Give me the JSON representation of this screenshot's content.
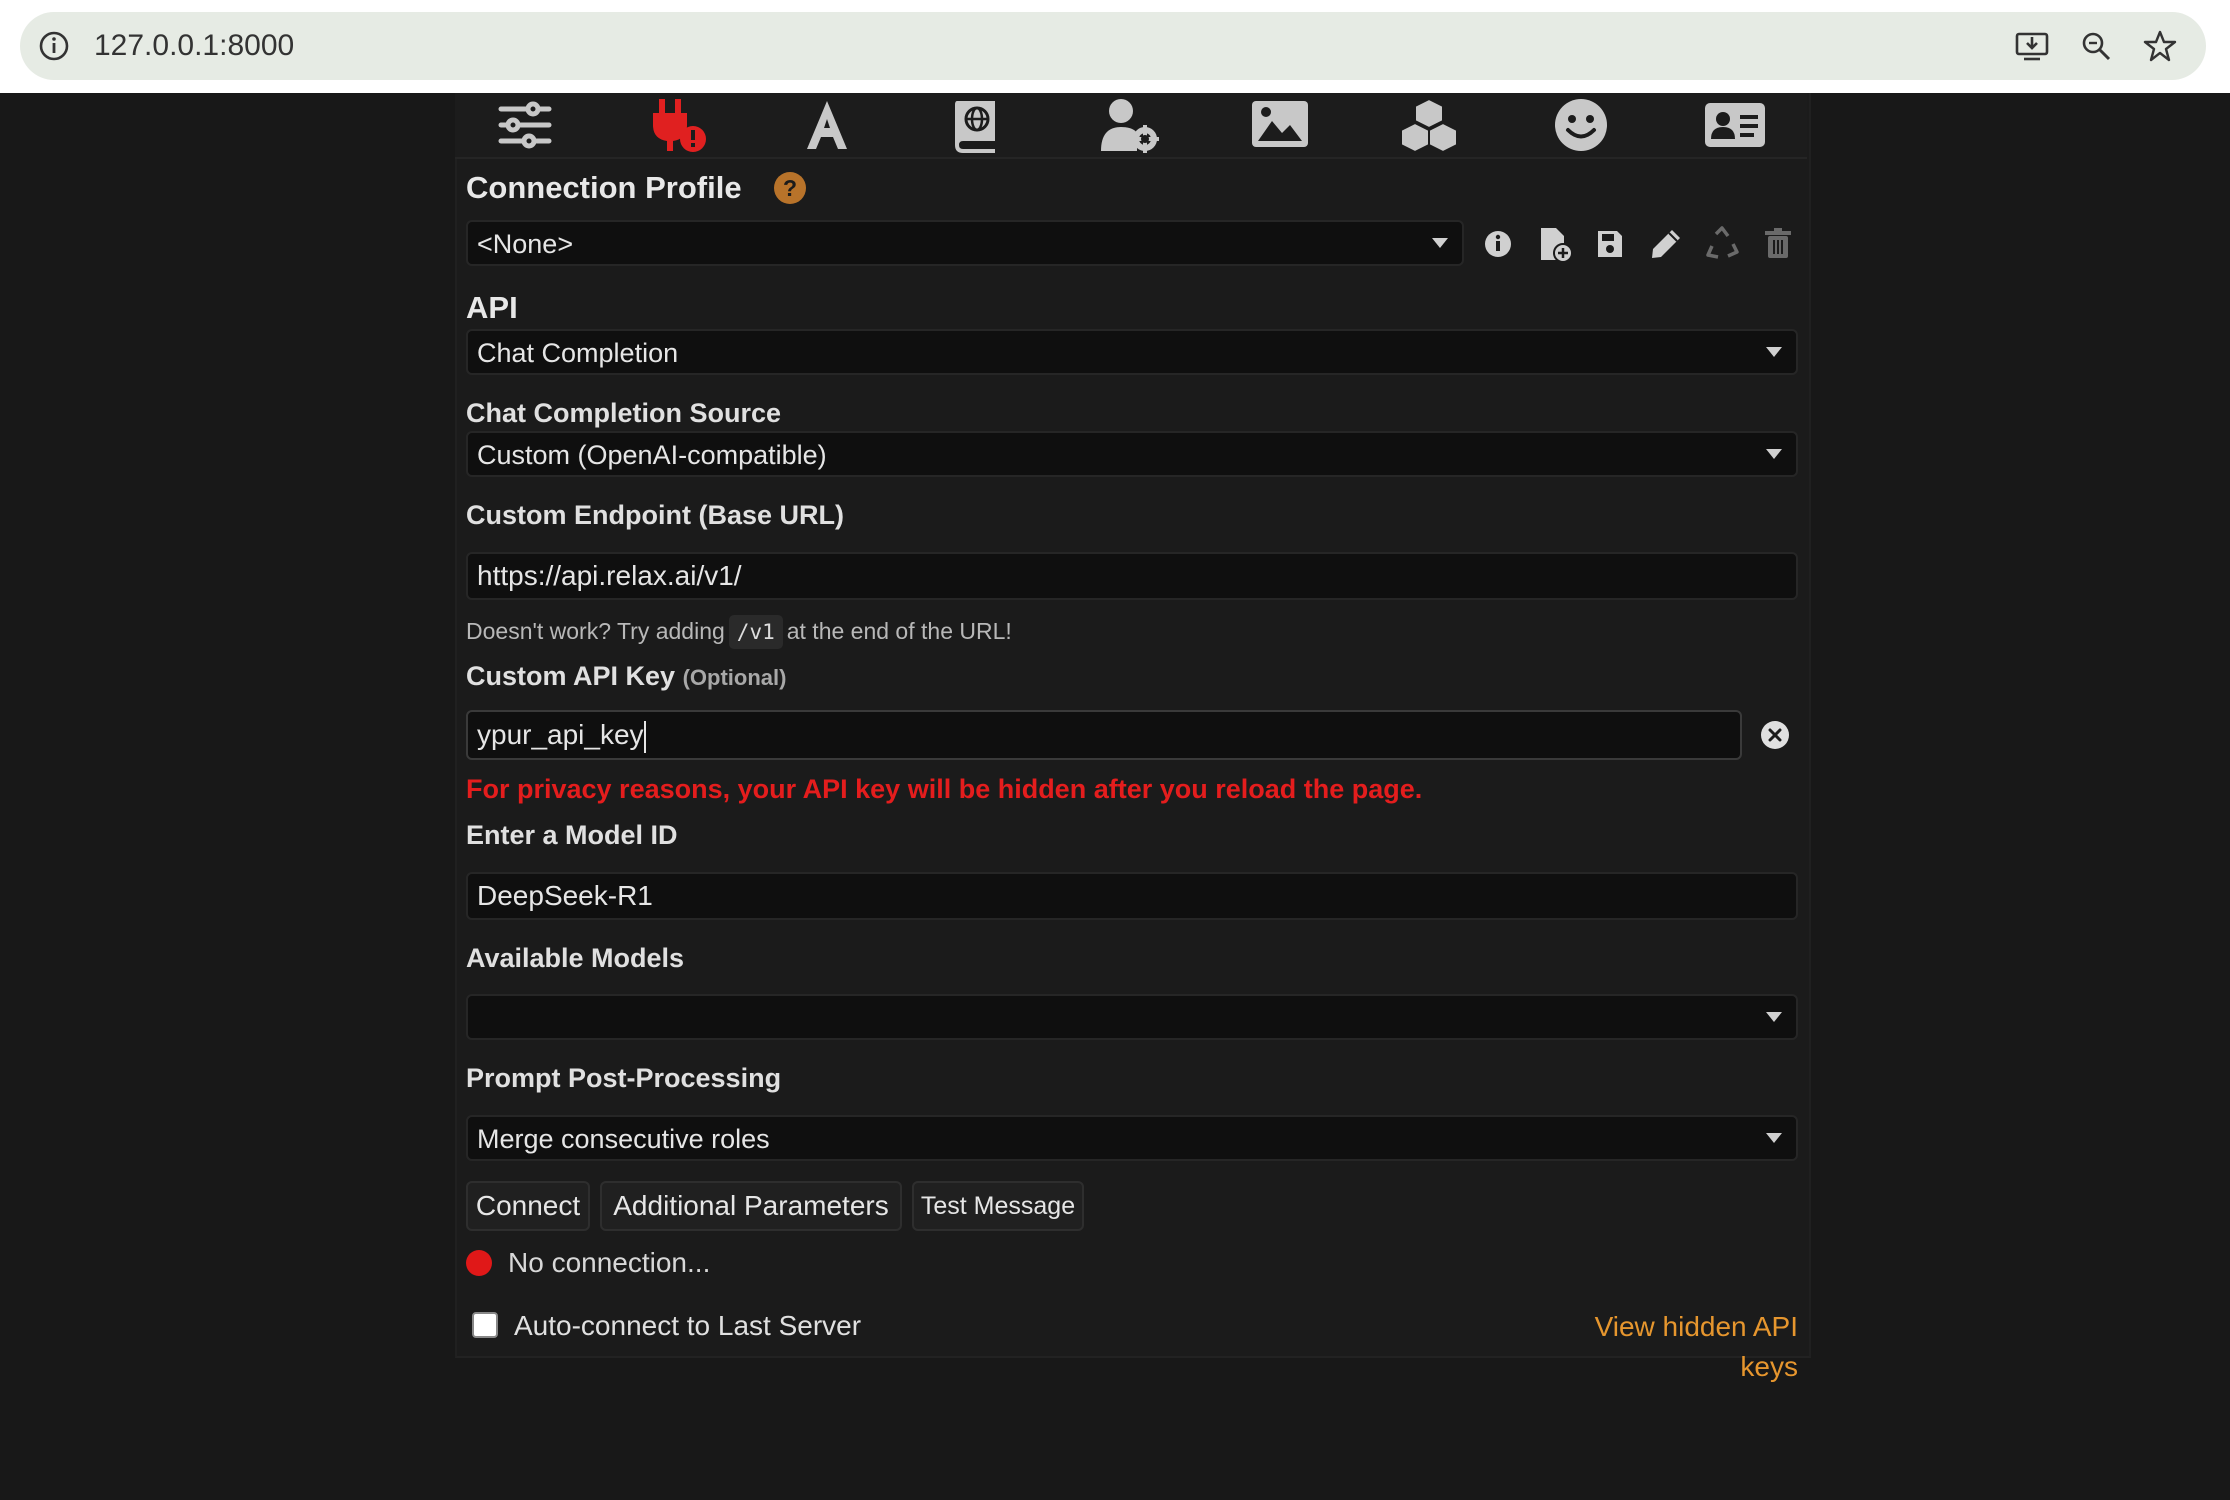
{
  "browser": {
    "url": "127.0.0.1:8000"
  },
  "tabs": [
    {
      "name": "sliders-icon",
      "color": "#c8c8c8"
    },
    {
      "name": "plug-warning-icon",
      "color": "#e02020"
    },
    {
      "name": "font-icon",
      "color": "#c8c8c8"
    },
    {
      "name": "world-book-icon",
      "color": "#c8c8c8"
    },
    {
      "name": "user-gear-icon",
      "color": "#c8c8c8"
    },
    {
      "name": "image-icon",
      "color": "#c8c8c8"
    },
    {
      "name": "cubes-icon",
      "color": "#c8c8c8"
    },
    {
      "name": "smiley-icon",
      "color": "#c8c8c8"
    },
    {
      "name": "id-card-icon",
      "color": "#c8c8c8"
    }
  ],
  "connection_profile": {
    "title": "Connection Profile",
    "help": "?",
    "selected": "<None>"
  },
  "api": {
    "label": "API",
    "selected": "Chat Completion"
  },
  "source": {
    "label": "Chat Completion Source",
    "selected": "Custom (OpenAI-compatible)"
  },
  "endpoint": {
    "label": "Custom Endpoint (Base URL)",
    "value": "https://api.relax.ai/v1/",
    "hint_before": "Doesn't work? Try adding",
    "hint_code": "/v1",
    "hint_after": "at the end of the URL!"
  },
  "api_key": {
    "label": "Custom API Key",
    "optional": "(Optional)",
    "value": "ypur_api_key",
    "warning": "For privacy reasons, your API key will be hidden after you reload the page."
  },
  "model_id": {
    "label": "Enter a Model ID",
    "value": "DeepSeek-R1"
  },
  "available_models": {
    "label": "Available Models",
    "selected": ""
  },
  "post_processing": {
    "label": "Prompt Post-Processing",
    "selected": "Merge consecutive roles"
  },
  "buttons": {
    "connect": "Connect",
    "additional": "Additional Parameters",
    "test": "Test Message"
  },
  "status": {
    "text": "No connection...",
    "color": "#e01818"
  },
  "auto_connect": {
    "label": "Auto-connect to Last Server",
    "checked": false
  },
  "hidden_keys_link": "View hidden API keys",
  "colors": {
    "accent_orange": "#e6962e",
    "warning_red": "#e41d1d",
    "help_badge": "#b8732a"
  }
}
